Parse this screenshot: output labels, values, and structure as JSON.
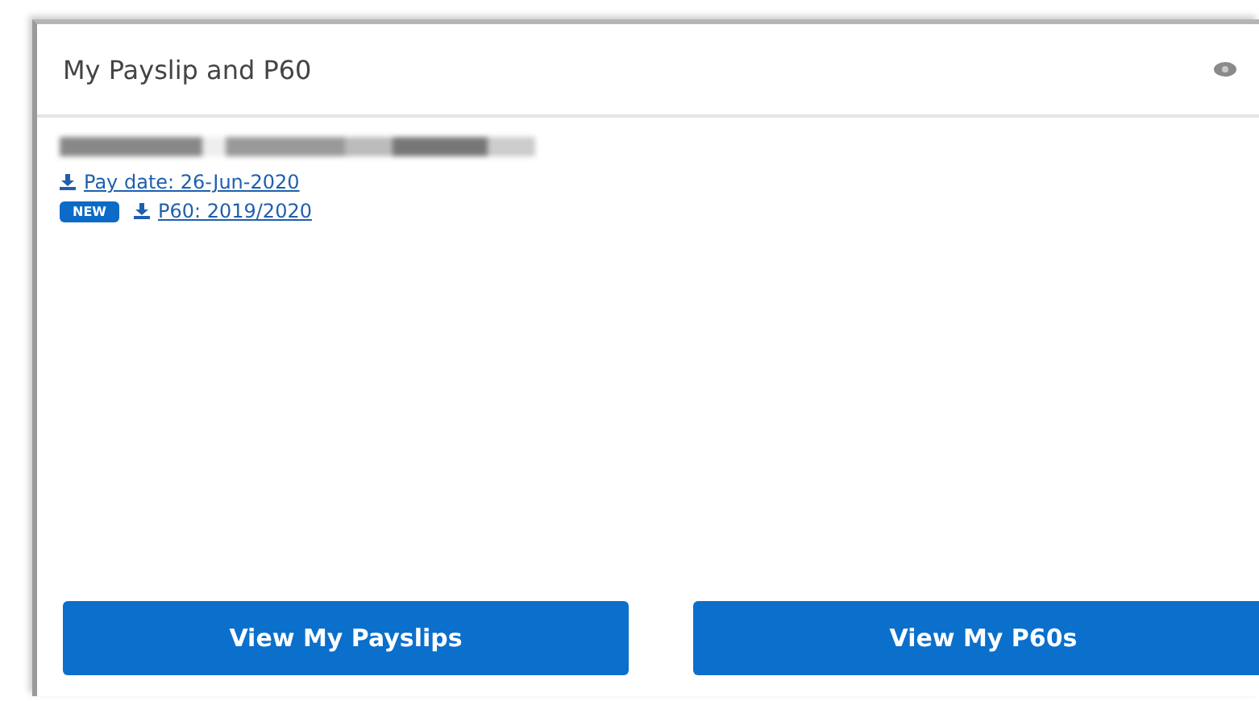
{
  "card": {
    "title": "My Payslip and P60"
  },
  "links": [
    {
      "label": "Pay date: 26-Jun-2020"
    },
    {
      "label": "P60: 2019/2020",
      "badge": "NEW"
    }
  ],
  "buttons": [
    "View My Payslips",
    "View My P60s"
  ]
}
